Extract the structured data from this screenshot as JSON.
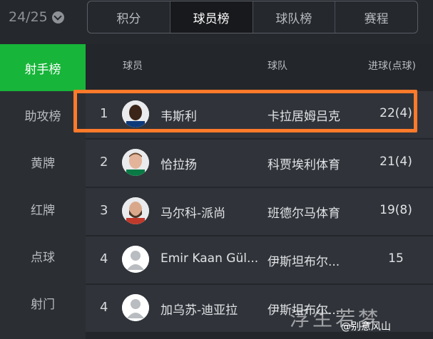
{
  "season": {
    "label": "24/25"
  },
  "tabs": [
    {
      "label": "积分"
    },
    {
      "label": "球员榜"
    },
    {
      "label": "球队榜"
    },
    {
      "label": "赛程"
    }
  ],
  "sidebar": [
    {
      "label": "射手榜"
    },
    {
      "label": "助攻榜"
    },
    {
      "label": "黄牌"
    },
    {
      "label": "红牌"
    },
    {
      "label": "点球"
    },
    {
      "label": "射门"
    }
  ],
  "table": {
    "headers": {
      "player": "球员",
      "team": "球队",
      "goals": "进球(点球)"
    },
    "rows": [
      {
        "rank": "1",
        "name": "韦斯利",
        "team": "卡拉居姆吕克",
        "goals": "22(4)"
      },
      {
        "rank": "2",
        "name": "恰拉扬",
        "team": "科贾埃利体育",
        "goals": "21(4)"
      },
      {
        "rank": "3",
        "name": "马尔科-派尚",
        "team": "班德尔马体育",
        "goals": "19(8)"
      },
      {
        "rank": "4",
        "name": "Emir Kaan Gül...",
        "team": "伊斯坦布尔...",
        "goals": "15"
      },
      {
        "rank": "4",
        "name": "加乌苏-迪亚拉",
        "team": "伊斯坦布尔...",
        "goals": ""
      }
    ]
  },
  "watermark": {
    "large": "浮生若梦",
    "small": "@别意风山"
  },
  "colors": {
    "accent": "#17b539",
    "highlight": "#ff7a2a"
  }
}
